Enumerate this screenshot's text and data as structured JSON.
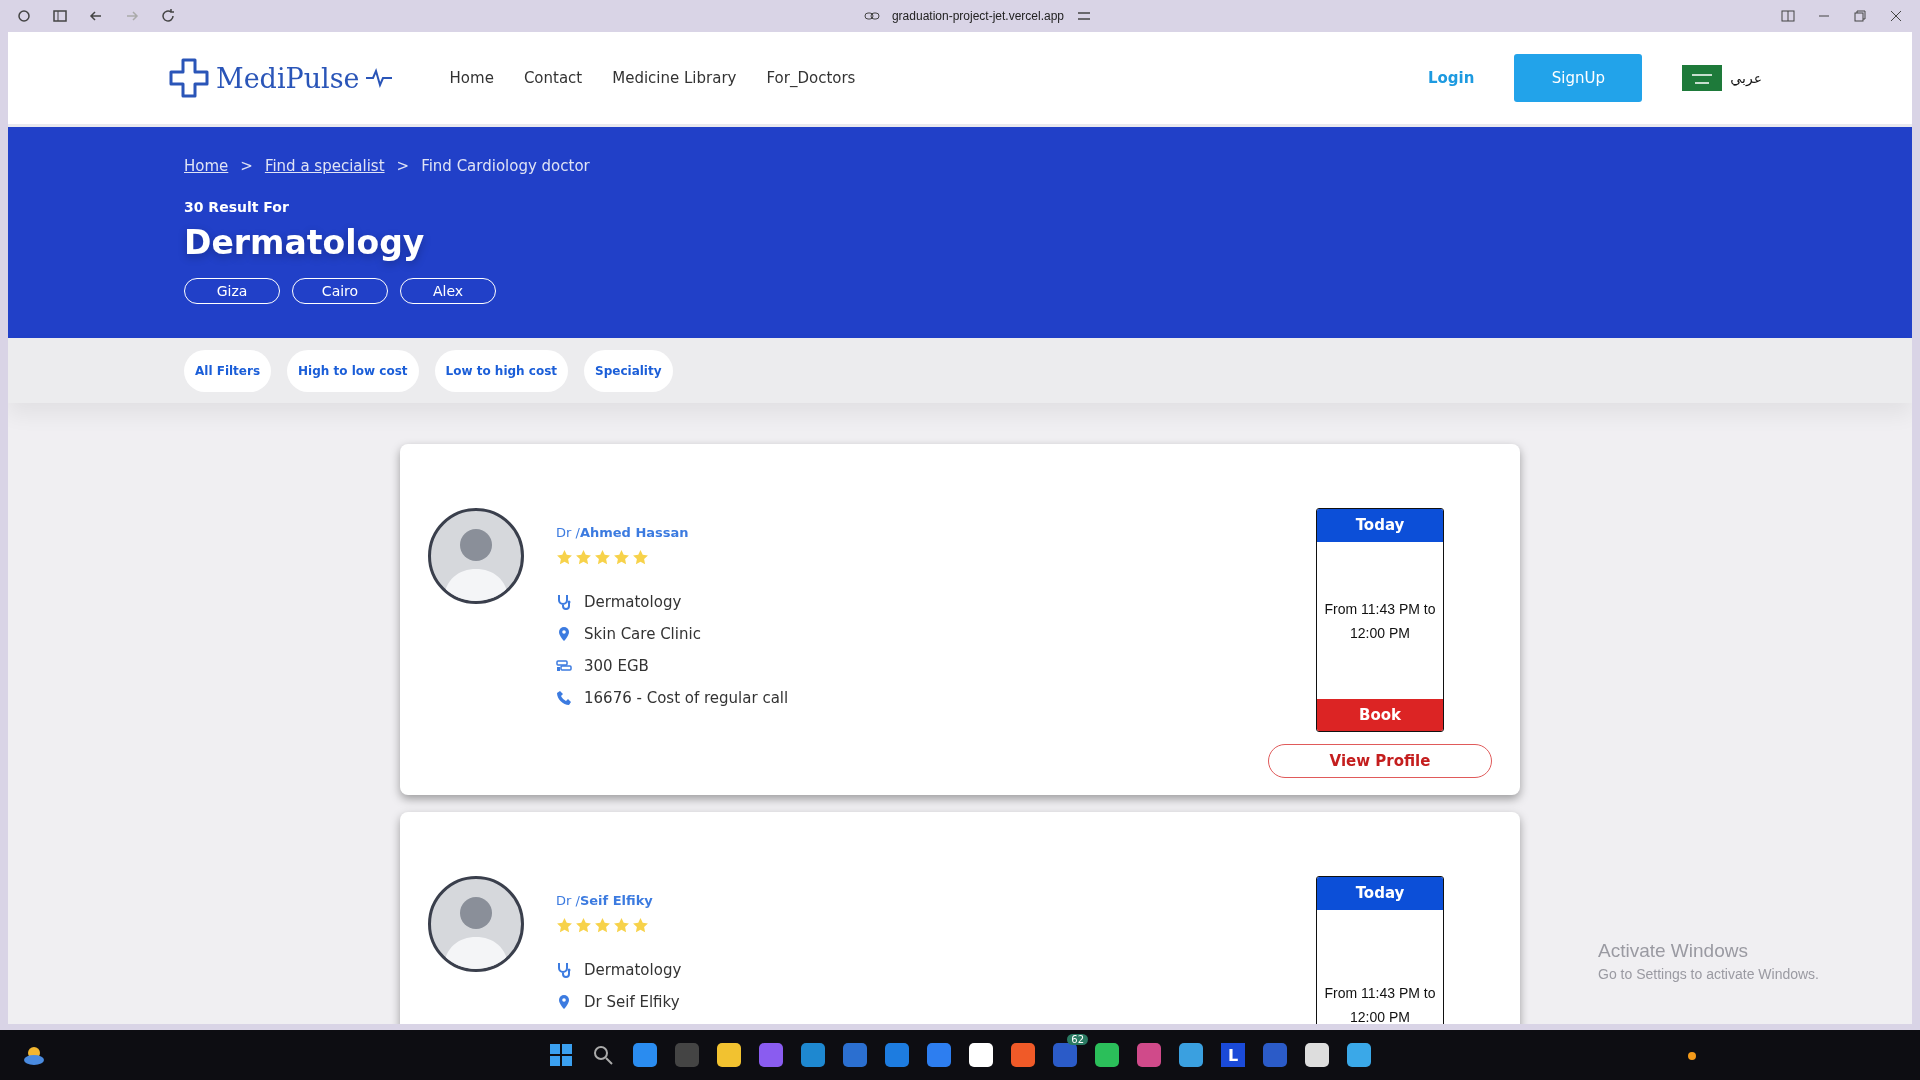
{
  "browser": {
    "url": "graduation-project-jet.vercel.app"
  },
  "header": {
    "logo": "MediPulse",
    "nav": [
      {
        "label": "Home"
      },
      {
        "label": "Contact"
      },
      {
        "label": "Medicine Library"
      },
      {
        "label": "For_Doctors"
      }
    ],
    "login": "Login",
    "signup": "SignUp",
    "language": "عربي"
  },
  "banner": {
    "breadcrumb": [
      {
        "label": "Home",
        "link": true
      },
      {
        "separator": ">",
        "label": "Find a specialist",
        "link": true
      },
      {
        "separator": ">",
        "label": "Find Cardiology doctor",
        "link": false
      }
    ],
    "result_count": "30 Result For",
    "specialty": "Dermatology",
    "cities": [
      "Giza",
      "Cairo",
      "Alex"
    ]
  },
  "filters": [
    "All Filters",
    "High to low cost",
    "Low to high cost",
    "Speciality"
  ],
  "doctors": [
    {
      "prefix": "Dr /",
      "name": "Ahmed Hassan",
      "stars": 5,
      "specialty": "Dermatology",
      "clinic": "Skin Care Clinic",
      "fee": "300 EGB",
      "phone": "16676 - Cost of regular call",
      "day": "Today",
      "time": "From 11:43 PM to 12:00 PM",
      "book": "Book",
      "profile": "View Profile"
    },
    {
      "prefix": "Dr /",
      "name": "Seif Elfiky",
      "stars": 5,
      "specialty": "Dermatology",
      "clinic": "Dr Seif Elfiky",
      "day": "Today",
      "time": "From 11:43 PM to 12:00 PM"
    }
  ],
  "windows_notice": {
    "title": "Activate Windows",
    "subtitle": "Go to Settings to activate Windows."
  },
  "taskbar": {
    "letter_tile": "L",
    "notification_badge": "62"
  }
}
